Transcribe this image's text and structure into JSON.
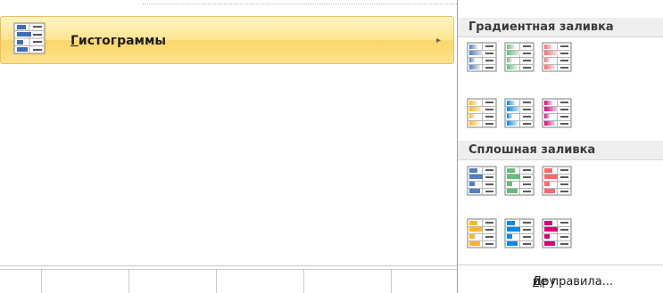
{
  "menu": {
    "item_label_accel": "Г",
    "item_label_rest": "истограммы",
    "submenu_arrow": "▸",
    "icon": "data-bars-icon"
  },
  "gallery": {
    "gradient_header": "Градиентная заливка",
    "solid_header": "Сплошная заливка",
    "gradient_fill": [
      {
        "name": "blue-gradient-data-bar-icon",
        "color": "#4f81bd"
      },
      {
        "name": "green-gradient-data-bar-icon",
        "color": "#63be7b"
      },
      {
        "name": "red-gradient-data-bar-icon",
        "color": "#f8696b"
      },
      {
        "name": "orange-gradient-data-bar-icon",
        "color": "#ffb628"
      },
      {
        "name": "lightblue-gradient-data-bar-icon",
        "color": "#008aef"
      },
      {
        "name": "purple-gradient-data-bar-icon",
        "color": "#d6007b"
      }
    ],
    "solid_fill": [
      {
        "name": "blue-solid-data-bar-icon",
        "color": "#4f81bd"
      },
      {
        "name": "green-solid-data-bar-icon",
        "color": "#63be7b"
      },
      {
        "name": "red-solid-data-bar-icon",
        "color": "#f8696b"
      },
      {
        "name": "orange-solid-data-bar-icon",
        "color": "#ffb628"
      },
      {
        "name": "lightblue-solid-data-bar-icon",
        "color": "#008aef"
      },
      {
        "name": "purple-solid-data-bar-icon",
        "color": "#d6007b"
      }
    ],
    "more_rules_before": "Дру",
    "more_rules_accel": "г",
    "more_rules_after": "ие правила..."
  },
  "colors": {
    "menu_highlight": "#fde58f",
    "menu_highlight_border": "#e9c25a",
    "header_bg": "#eeeeee"
  }
}
